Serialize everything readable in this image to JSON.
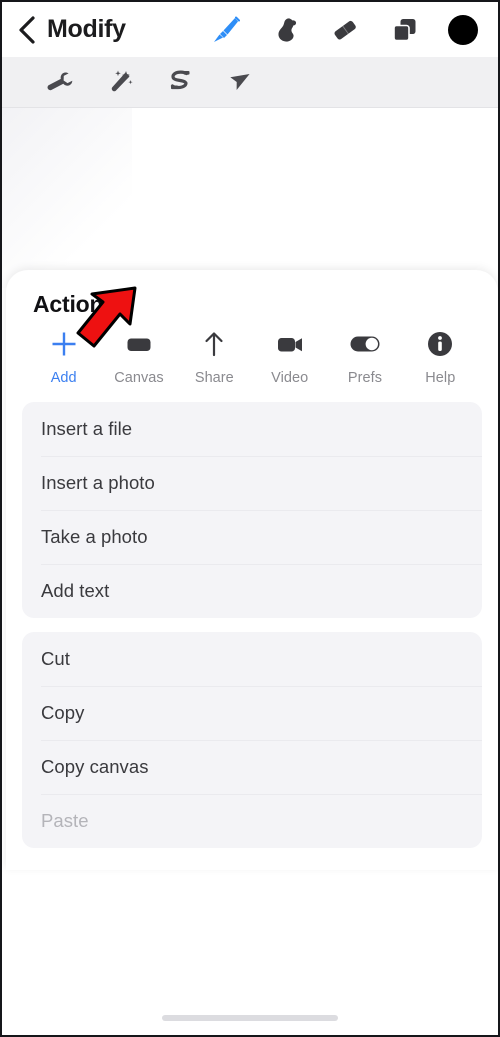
{
  "navbar": {
    "back_label": "back-chevron",
    "title": "Modify",
    "tools": [
      {
        "name": "brush-icon",
        "label": "Brush",
        "selected": true
      },
      {
        "name": "smudge-icon",
        "label": "Smudge",
        "selected": false
      },
      {
        "name": "eraser-icon",
        "label": "Eraser",
        "selected": false
      },
      {
        "name": "layers-icon",
        "label": "Layers",
        "selected": false
      },
      {
        "name": "color-swatch",
        "label": "Color",
        "color": "#000000"
      }
    ]
  },
  "subbar": {
    "tools": [
      {
        "name": "wrench-icon",
        "label": "Adjustments"
      },
      {
        "name": "magic-wand-icon",
        "label": "Effects"
      },
      {
        "name": "distort-icon",
        "label": "Liquify"
      },
      {
        "name": "select-arrow-icon",
        "label": "Select"
      }
    ]
  },
  "sheet": {
    "title": "Actions",
    "quick_actions": [
      {
        "icon": "plus-icon",
        "label": "Add",
        "accent": true
      },
      {
        "icon": "canvas-icon",
        "label": "Canvas",
        "accent": false
      },
      {
        "icon": "share-icon",
        "label": "Share",
        "accent": false
      },
      {
        "icon": "video-icon",
        "label": "Video",
        "accent": false
      },
      {
        "icon": "toggle-icon",
        "label": "Prefs",
        "accent": false
      },
      {
        "icon": "info-icon",
        "label": "Help",
        "accent": false
      }
    ],
    "groups": [
      {
        "id": "insert",
        "rows": [
          {
            "label": "Insert a file",
            "disabled": false
          },
          {
            "label": "Insert a photo",
            "disabled": false
          },
          {
            "label": "Take a photo",
            "disabled": false
          },
          {
            "label": "Add text",
            "disabled": false
          }
        ]
      },
      {
        "id": "clipboard",
        "rows": [
          {
            "label": "Cut",
            "disabled": false
          },
          {
            "label": "Copy",
            "disabled": false
          },
          {
            "label": "Copy canvas",
            "disabled": false
          },
          {
            "label": "Paste",
            "disabled": true
          }
        ]
      }
    ]
  },
  "annotation": {
    "name": "red-arrow-pointer",
    "color": "#ee1111",
    "outline": "#000000",
    "points_at": "Add"
  },
  "colors": {
    "accent_blue": "#3b7ff0",
    "icon_dark": "#3a3a3e",
    "label_gray": "#8a8a8f",
    "disabled_gray": "#b4b4b9",
    "list_bg": "#f4f4f7",
    "subbar_bg": "#f0f0f2"
  }
}
